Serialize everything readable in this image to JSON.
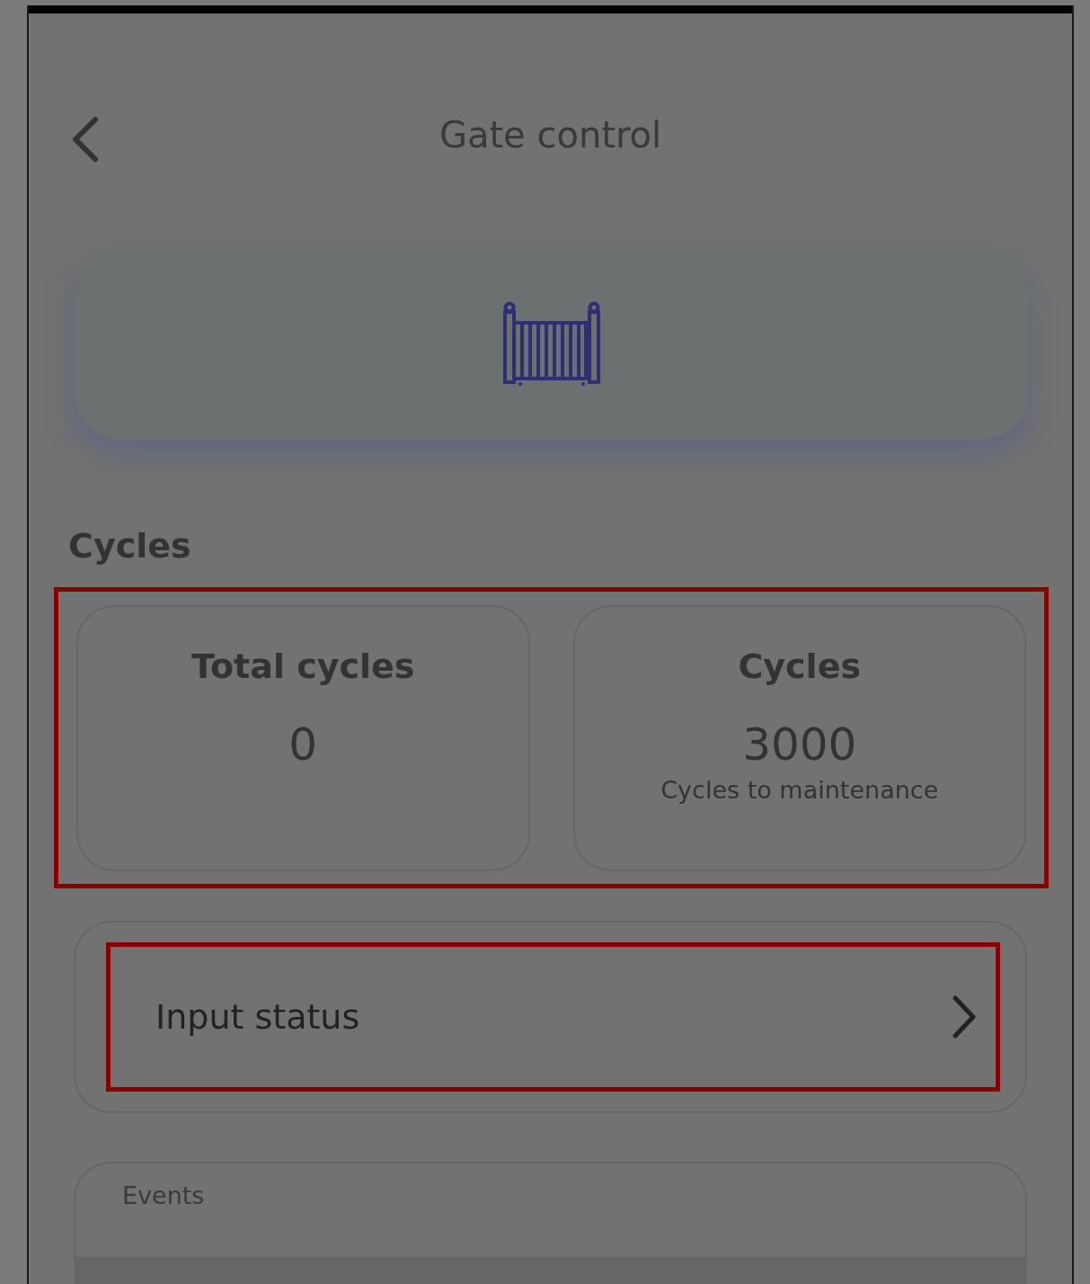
{
  "header": {
    "title": "Gate control"
  },
  "cycles": {
    "heading": "Cycles",
    "stats": [
      {
        "title": "Total cycles",
        "value": "0"
      },
      {
        "title": "Cycles",
        "value": "3000",
        "caption": "Cycles to maintenance"
      }
    ]
  },
  "input_status": {
    "label": "Input status"
  },
  "events": {
    "label": "Events"
  }
}
